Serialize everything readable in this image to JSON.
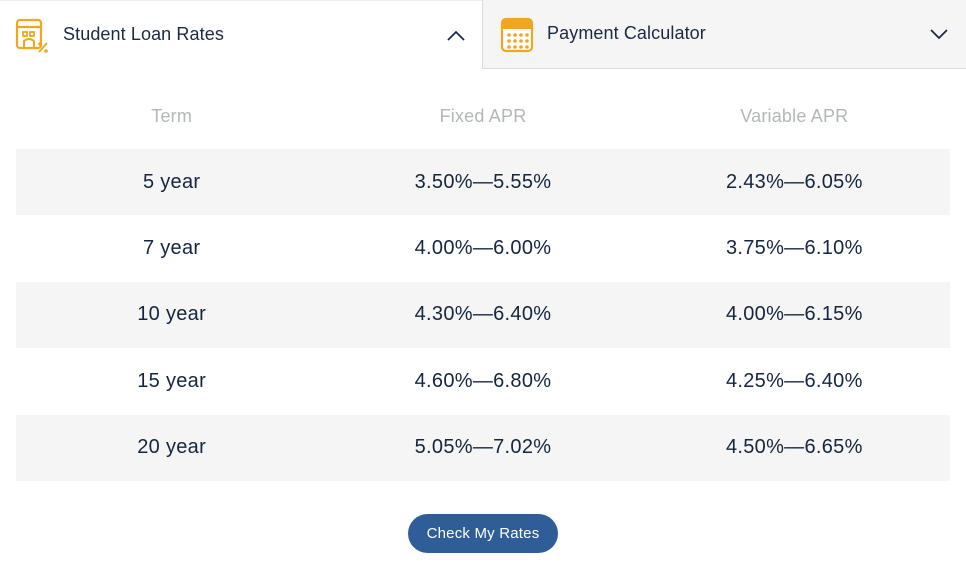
{
  "tabs": [
    {
      "label": "Student Loan Rates",
      "icon": "loan-rates-icon",
      "state": "expanded"
    },
    {
      "label": "Payment Calculator",
      "icon": "calculator-icon",
      "state": "collapsed"
    }
  ],
  "colors": {
    "accent_icon": "#f0a623",
    "text_dark": "#1a2a44",
    "header_muted": "#b3b6bb",
    "row_shade": "#f5f5f5",
    "button_bg": "#2f5d97"
  },
  "table": {
    "headers": [
      "Term",
      "Fixed APR",
      "Variable APR"
    ],
    "rows": [
      [
        "5 year",
        "3.50%—5.55%",
        "2.43%—6.05%"
      ],
      [
        "7 year",
        "4.00%—6.00%",
        "3.75%—6.10%"
      ],
      [
        "10 year",
        "4.30%—6.40%",
        "4.00%—6.15%"
      ],
      [
        "15 year",
        "4.60%—6.80%",
        "4.25%—6.40%"
      ],
      [
        "20 year",
        "5.05%—7.02%",
        "4.50%—6.65%"
      ]
    ]
  },
  "cta": {
    "label": "Check My Rates"
  }
}
